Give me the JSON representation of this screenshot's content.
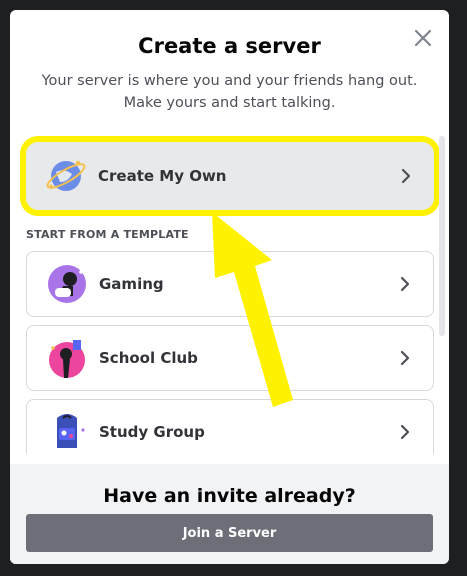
{
  "modal": {
    "title": "Create a server",
    "subtitle": "Your server is where you and your friends hang out. Make yours and start talking."
  },
  "options": {
    "create_own": "Create My Own",
    "section_header": "START FROM A TEMPLATE",
    "templates": [
      {
        "label": "Gaming",
        "icon": "gaming-icon"
      },
      {
        "label": "School Club",
        "icon": "school-club-icon"
      },
      {
        "label": "Study Group",
        "icon": "study-group-icon"
      }
    ]
  },
  "footer": {
    "question": "Have an invite already?",
    "join_label": "Join a Server"
  },
  "colors": {
    "highlight": "#fff200",
    "join_button": "#6d6f78"
  }
}
